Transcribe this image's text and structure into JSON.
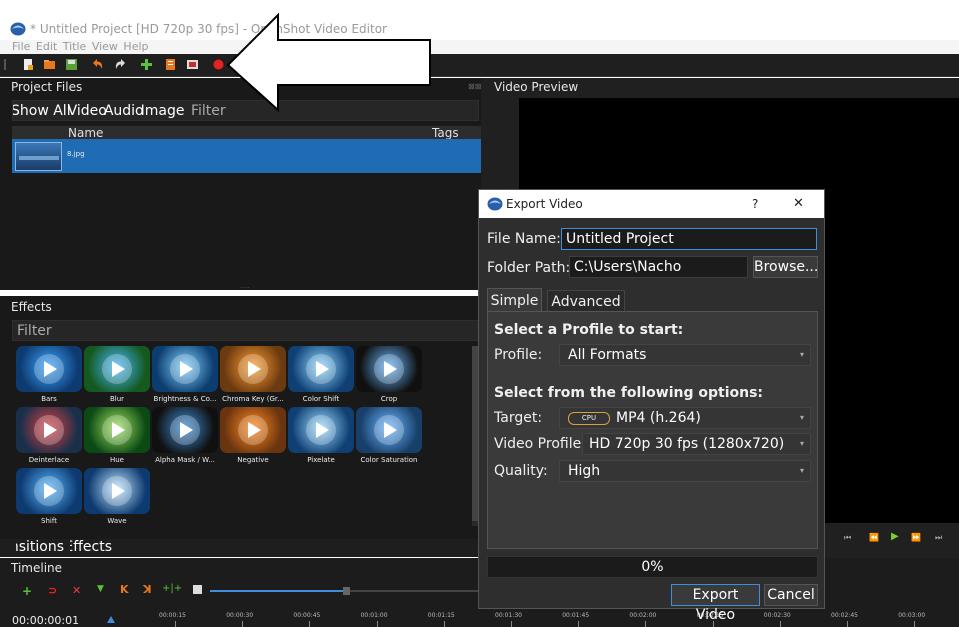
{
  "window": {
    "title": "* Untitled Project [HD 720p 30 fps] - OpenShot Video Editor"
  },
  "menu": [
    "File",
    "Edit",
    "Title",
    "View",
    "Help"
  ],
  "project_files": {
    "title": "Project Files",
    "filter_tabs": [
      "Show All",
      "Video",
      "Audio",
      "Image"
    ],
    "filter_placeholder": "Filter",
    "columns": {
      "name": "Name",
      "tags": "Tags"
    },
    "files": [
      {
        "name": "8.jpg"
      }
    ]
  },
  "video_preview": {
    "title": "Video Preview"
  },
  "effects": {
    "title": "Effects",
    "filter_placeholder": "Filter",
    "items": [
      {
        "label": "Bars"
      },
      {
        "label": "Blur"
      },
      {
        "label": "Brightness & Co..."
      },
      {
        "label": "Chroma Key (Gr..."
      },
      {
        "label": "Color Shift"
      },
      {
        "label": "Crop"
      },
      {
        "label": "Deinterlace"
      },
      {
        "label": "Hue"
      },
      {
        "label": "Alpha Mask / W..."
      },
      {
        "label": "Negative"
      },
      {
        "label": "Pixelate"
      },
      {
        "label": "Color Saturation"
      },
      {
        "label": "Shift"
      },
      {
        "label": "Wave"
      }
    ]
  },
  "bottom_tabs": {
    "transitions": "Transitions",
    "effects": "Effects"
  },
  "timeline": {
    "title": "Timeline",
    "timecode": "00:00:00:01",
    "ticks": [
      "00:00:15",
      "00:00:30",
      "00:00:45",
      "00:01:00",
      "00:01:15",
      "00:01:30",
      "00:01:45",
      "00:02:00",
      "00:02:15",
      "00:02:30",
      "00:02:45",
      "00:03:00"
    ]
  },
  "dialog": {
    "title": "Export Video",
    "help": "?",
    "close": "✕",
    "file_name_label": "File Name:",
    "file_name_value": "Untitled Project",
    "folder_path_label": "Folder Path:",
    "folder_path_value": "C:\\Users\\Nacho",
    "browse": "Browse...",
    "tabs": {
      "simple": "Simple",
      "advanced": "Advanced"
    },
    "profile_heading": "Select a Profile to start:",
    "profile_label": "Profile:",
    "profile_value": "All Formats",
    "options_heading": "Select from the following options:",
    "target_label": "Target:",
    "target_badge": "CPU",
    "target_value": "MP4 (h.264)",
    "video_profile_label": "Video Profile:",
    "video_profile_value": "HD 720p 30 fps (1280x720)",
    "quality_label": "Quality:",
    "quality_value": "High",
    "progress_text": "0%",
    "progress": 0,
    "export_button": "Export Video",
    "cancel_button": "Cancel"
  },
  "colors": {
    "selection": "#1f6cb5",
    "accent_border": "#3d8fd9",
    "record": "#e52222"
  }
}
